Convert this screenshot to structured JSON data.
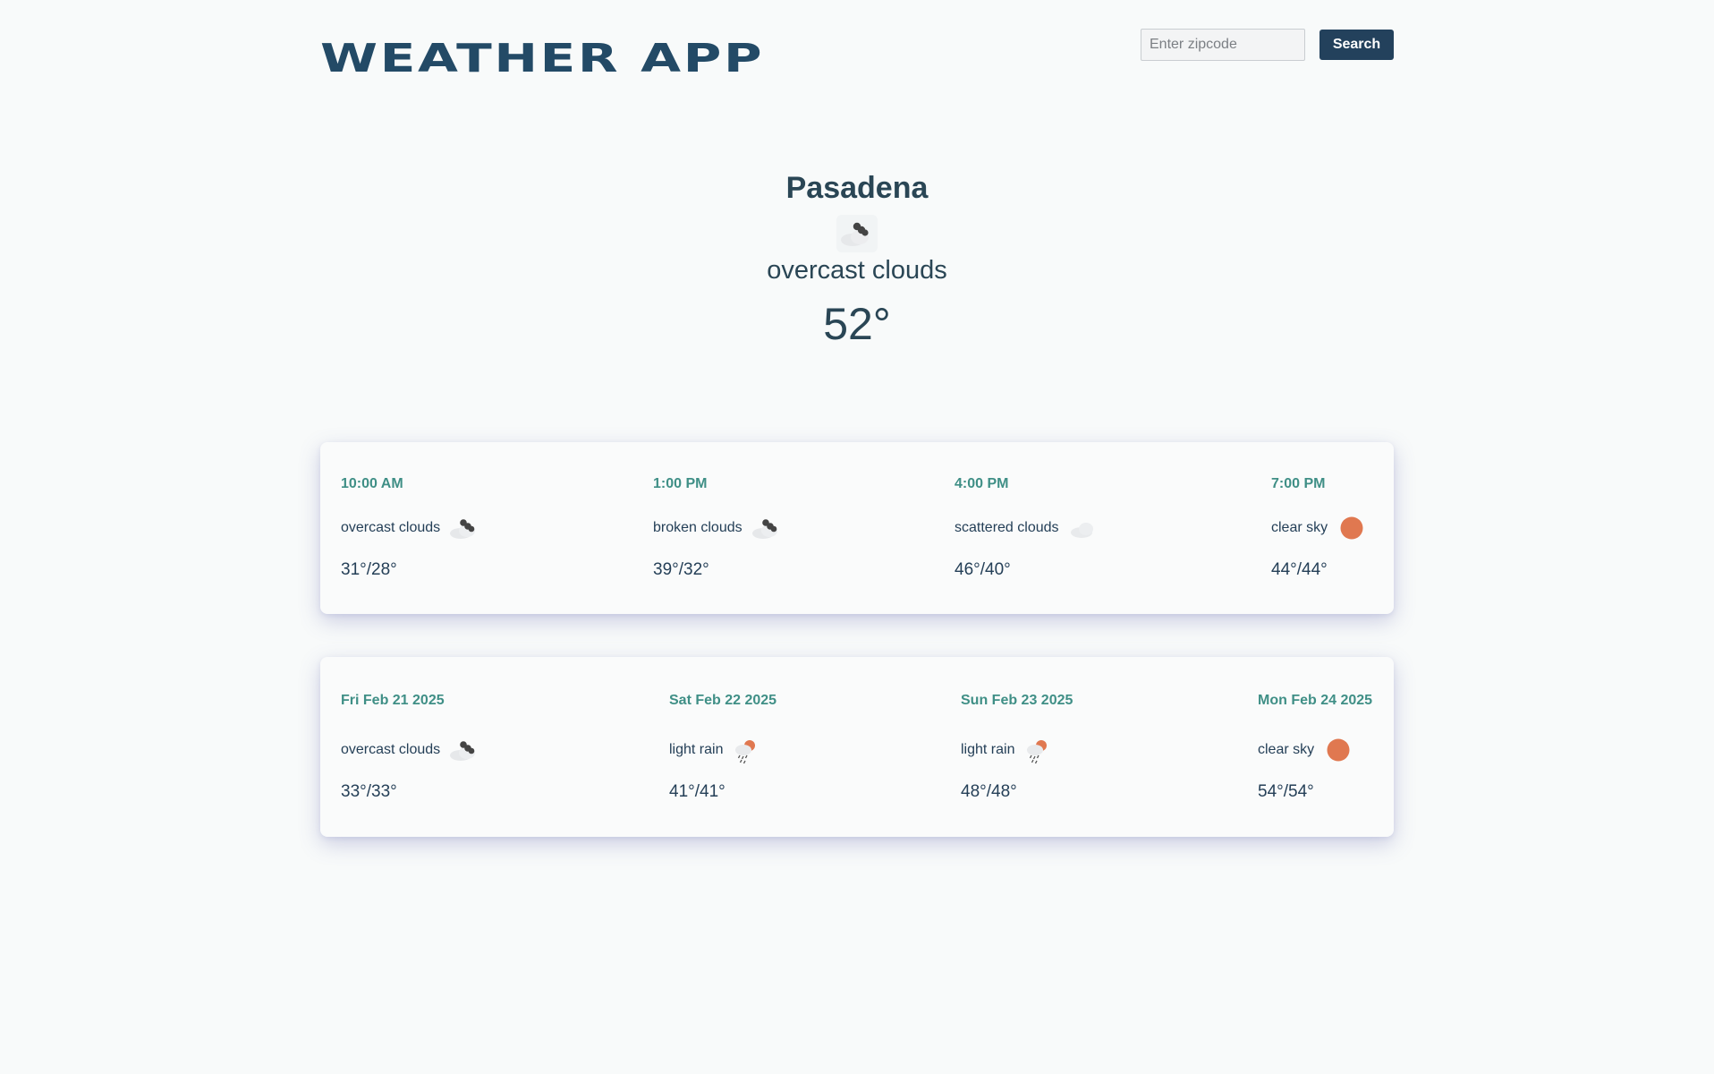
{
  "header": {
    "title": "WEATHER APP",
    "zip_placeholder": "Enter zipcode",
    "search_label": "Search"
  },
  "current": {
    "city": "Pasadena",
    "icon": "overcast-clouds-icon",
    "description": "overcast clouds",
    "temperature": "52°"
  },
  "hourly": [
    {
      "time": "10:00 AM",
      "description": "overcast clouds",
      "icon": "overcast-clouds-icon",
      "temps": "31°/28°"
    },
    {
      "time": "1:00 PM",
      "description": "broken clouds",
      "icon": "broken-clouds-icon",
      "temps": "39°/32°"
    },
    {
      "time": "4:00 PM",
      "description": "scattered clouds",
      "icon": "scattered-clouds-icon",
      "temps": "46°/40°"
    },
    {
      "time": "7:00 PM",
      "description": "clear sky",
      "icon": "clear-sky-icon",
      "temps": "44°/44°"
    }
  ],
  "daily": [
    {
      "date": "Fri Feb 21 2025",
      "description": "overcast clouds",
      "icon": "overcast-clouds-icon",
      "temps": "33°/33°"
    },
    {
      "date": "Sat Feb 22 2025",
      "description": "light rain",
      "icon": "light-rain-icon",
      "temps": "41°/41°"
    },
    {
      "date": "Sun Feb 23 2025",
      "description": "light rain",
      "icon": "light-rain-icon",
      "temps": "48°/48°"
    },
    {
      "date": "Mon Feb 24 2025",
      "description": "clear sky",
      "icon": "clear-sky-icon",
      "temps": "54°/54°"
    }
  ],
  "colors": {
    "brand": "#234a66",
    "accent_teal": "#3f8f86",
    "button": "#23415c",
    "sun": "#e07850"
  }
}
